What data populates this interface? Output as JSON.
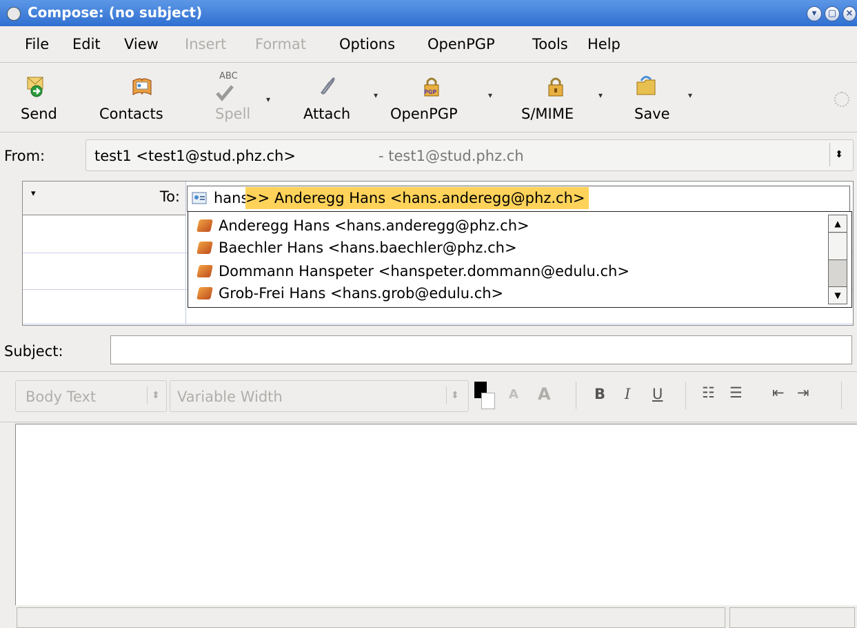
{
  "window": {
    "title": "Compose: (no subject)"
  },
  "menu": [
    "File",
    "Edit",
    "View",
    "Insert",
    "Format",
    "Options",
    "OpenPGP",
    "Tools",
    "Help"
  ],
  "toolbar": {
    "send": "Send",
    "contacts": "Contacts",
    "spell": "Spell",
    "attach": "Attach",
    "openpgp": "OpenPGP",
    "smime": "S/MIME",
    "save": "Save",
    "spell_icon_text": "ABC",
    "pgp_icon_text": "PGP"
  },
  "from": {
    "label": "From:",
    "value": "test1 <test1@stud.phz.ch>",
    "account": "- test1@stud.phz.ch"
  },
  "to": {
    "label": "To:",
    "typed": "hans",
    "completion": " >> Anderegg Hans <hans.anderegg@phz.ch>"
  },
  "autocomplete": [
    "Anderegg Hans <hans.anderegg@phz.ch>",
    "Baechler Hans <hans.baechler@phz.ch>",
    "Dommann Hanspeter <hanspeter.dommann@edulu.ch>",
    "Grob-Frei Hans <hans.grob@edulu.ch>"
  ],
  "subject": {
    "label": "Subject:",
    "value": ""
  },
  "format": {
    "paragraph": "Body Text",
    "font": "Variable Width",
    "bold": "B",
    "italic": "I",
    "underline": "U",
    "smaller_text": "A",
    "larger_text": "A"
  },
  "colors": {
    "titlebar": "#3a7bd8",
    "highlight": "#ffd35a"
  }
}
